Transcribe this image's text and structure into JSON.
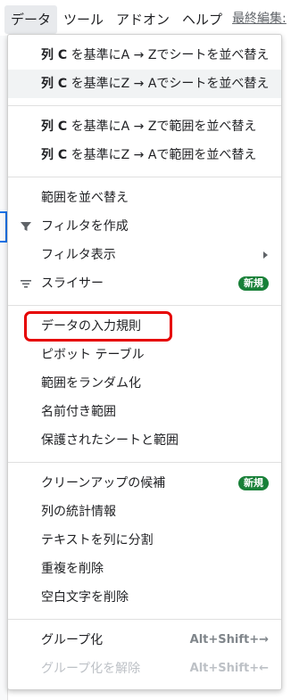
{
  "menubar": {
    "items": [
      "データ",
      "ツール",
      "アドオン",
      "ヘルプ"
    ],
    "last_edit": "最終編集:"
  },
  "menu": {
    "sort_sheet_az_prefix": "列 C",
    "sort_sheet_az_suffix": " を基準にA → Zでシートを並べ替え",
    "sort_sheet_za_prefix": "列 C",
    "sort_sheet_za_suffix": " を基準にZ → Aでシートを並べ替え",
    "sort_range_az_prefix": "列 C",
    "sort_range_az_suffix": " を基準にA → Zで範囲を並べ替え",
    "sort_range_za_prefix": "列 C",
    "sort_range_za_suffix": " を基準にZ → Aで範囲を並べ替え",
    "sort_range": "範囲を並べ替え",
    "create_filter": "フィルタを作成",
    "filter_views": "フィルタ表示",
    "slicer": "スライサー",
    "new_badge": "新規",
    "data_validation": "データの入力規則",
    "pivot_table": "ピボット テーブル",
    "randomize_range": "範囲をランダム化",
    "named_ranges": "名前付き範囲",
    "protected_sheets": "保護されたシートと範囲",
    "cleanup_suggestions": "クリーンアップの候補",
    "column_stats": "列の統計情報",
    "split_text": "テキストを列に分割",
    "remove_duplicates": "重複を削除",
    "trim_whitespace": "空白文字を削除",
    "group": "グループ化",
    "group_shortcut": "Alt+Shift+→",
    "ungroup": "グループ化を解除",
    "ungroup_shortcut": "Alt+Shift+←"
  },
  "colors": {
    "highlight": "#e60000",
    "badge": "#188038"
  }
}
